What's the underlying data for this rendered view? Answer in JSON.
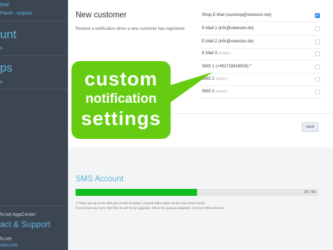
{
  "sidebar": {
    "link_mail": "Mail",
    "link_panel": "Panel - vcipaul",
    "heading_account": "unt",
    "link_account": "s",
    "heading_apps": "ps",
    "link_apps": "e",
    "appcenter_label": "N.net AppCenter",
    "contact_heading": "act & Support",
    "contact_name": "N.net",
    "contact_link": "sion.net"
  },
  "notification": {
    "title": "New customer",
    "description": "Receive a notification when a new customer has registered.",
    "recipients": [
      {
        "label": "Shop E-Mail",
        "detail": "(seoshop@viewsion.net)",
        "checked": true
      },
      {
        "label": "E-Mail 1",
        "detail": "(info@viewsion.de)",
        "checked": false
      },
      {
        "label": "E-Mail 2",
        "detail": "(info@viewsion.de)",
        "checked": false
      },
      {
        "label": "E-Mail 3",
        "detail": "(empty)",
        "checked": false
      },
      {
        "label": "SMS 1",
        "detail": "(+491718418918) *",
        "checked": false
      },
      {
        "label": "SMS 2",
        "detail": "(empty)",
        "checked": false
      },
      {
        "label": "SMS 3",
        "detail": "(empty)",
        "checked": false
      }
    ],
    "save_label": "save"
  },
  "callout": {
    "line1": "custom",
    "line2": "notification",
    "line3": "settings",
    "color": "#66cc11"
  },
  "sms_account": {
    "title": "SMS Account",
    "used": 25,
    "total": 50,
    "usage_text": "25 / 50",
    "note1": "*) There are up to 50 SMS per month included. Unused SMS expire at the end of the month.",
    "note2": "If you need any more, feel free to ask for an upgrade. When the quota is depleted, no more SMS are sent."
  },
  "colors": {
    "sidebar_bg": "#3c4652",
    "sidebar_link": "#5fb2de",
    "progress_fill": "#11bd21",
    "checkbox_on": "#2f80ed"
  }
}
